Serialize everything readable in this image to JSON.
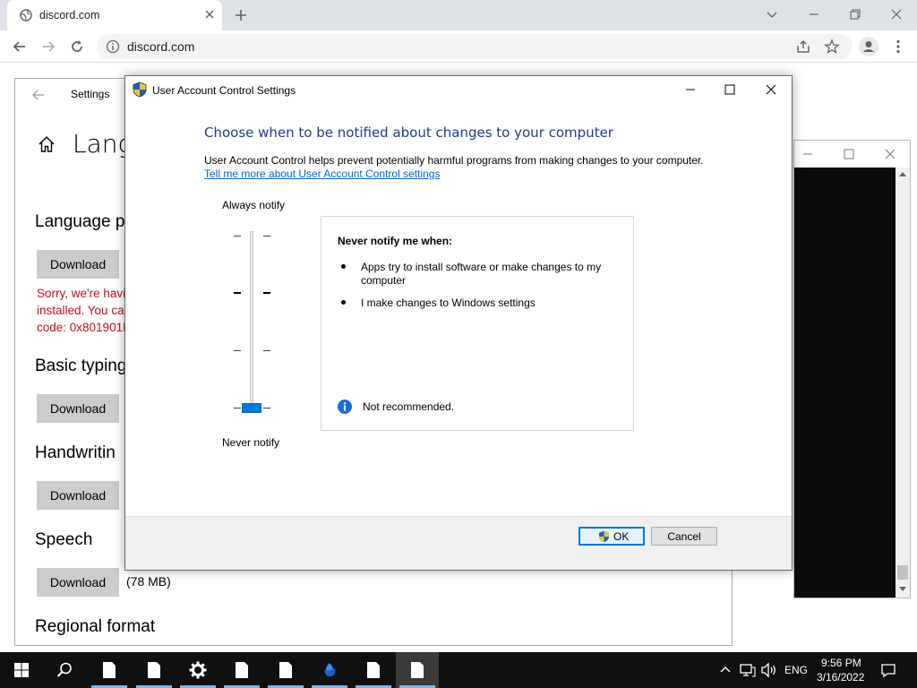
{
  "browser": {
    "tab_title": "discord.com",
    "url": "discord.com"
  },
  "settings": {
    "app_title": "Settings",
    "page_title": "Lang",
    "sections": [
      {
        "heading": "Language p",
        "button": "Download"
      },
      {
        "heading": "Basic typing",
        "button": "Download"
      },
      {
        "heading": "Handwritin",
        "button": "Download"
      },
      {
        "heading": "Speech",
        "button": "Download",
        "size": "(78 MB)"
      },
      {
        "heading": "Regional format"
      }
    ],
    "error_lines": [
      "Sorry, we're havi",
      "installed. You ca",
      "code: 0x801901F"
    ]
  },
  "uac": {
    "window_title": "User Account Control Settings",
    "heading": "Choose when to be notified about changes to your computer",
    "description": "User Account Control helps prevent potentially harmful programs from making changes to your computer.",
    "link": "Tell me more about User Account Control settings",
    "slider": {
      "top_label": "Always notify",
      "bottom_label": "Never notify",
      "levels": 4,
      "selected_level": 1
    },
    "info": {
      "heading": "Never notify me when:",
      "bullets": [
        "Apps try to install software or make changes to my computer",
        "I make changes to Windows settings"
      ],
      "note": "Not recommended."
    },
    "ok_label": "OK",
    "cancel_label": "Cancel"
  },
  "taskbar": {
    "language": "ENG",
    "time": "9:56 PM",
    "date": "3/16/2022"
  },
  "colors": {
    "accent": "#0078d7",
    "heading_blue": "#1e3d8f",
    "error_red": "#c50f1f",
    "link_blue": "#0066cc"
  }
}
